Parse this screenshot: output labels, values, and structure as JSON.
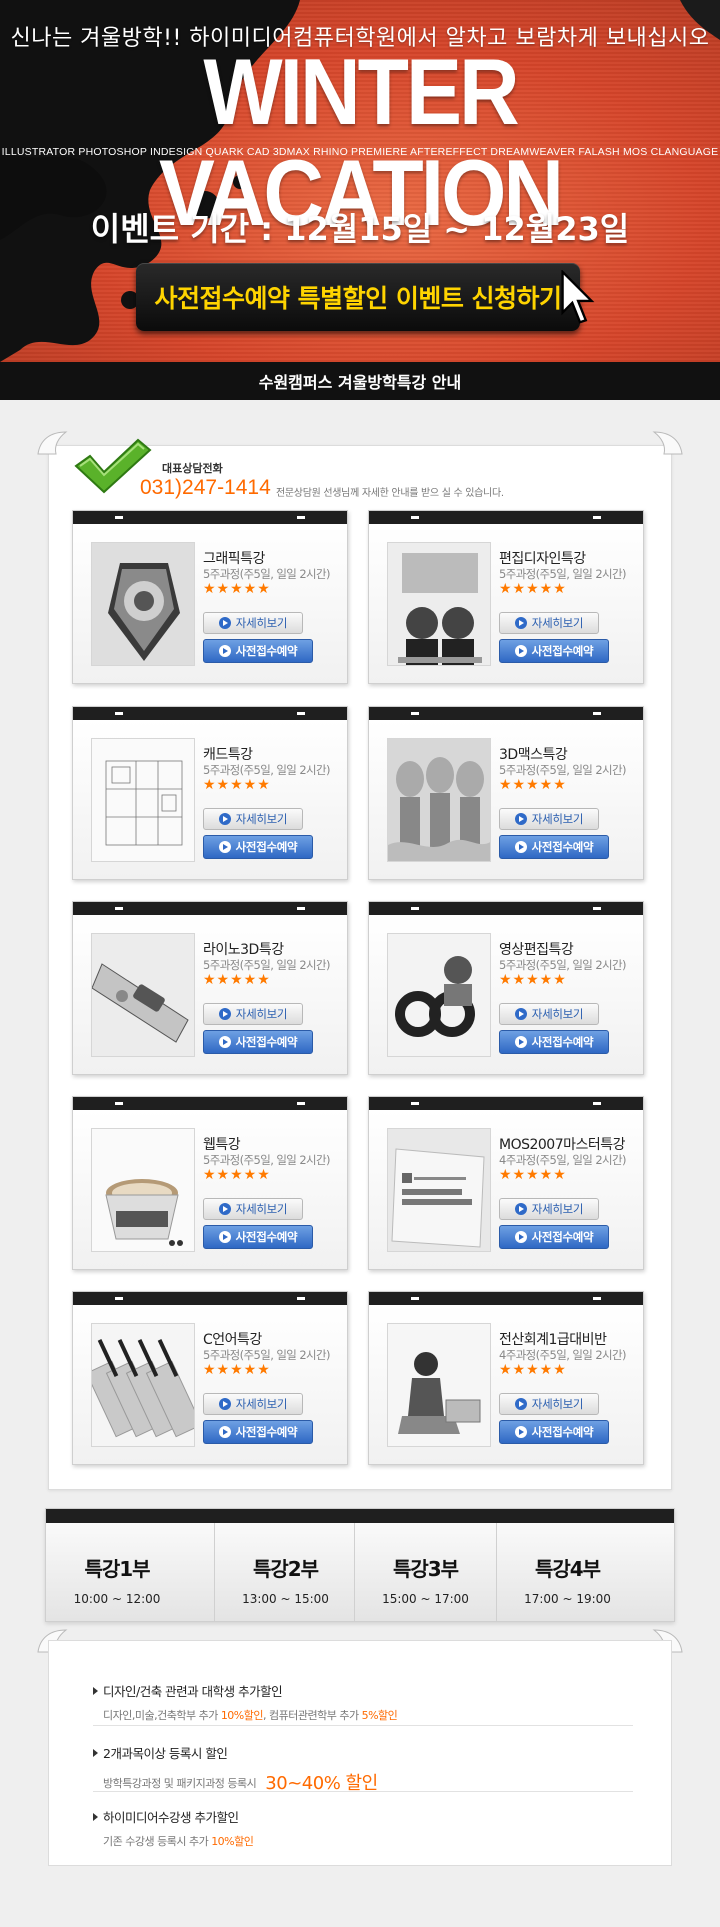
{
  "hero": {
    "tagline": "신나는 겨울방학!! 하이미디어컴퓨터학원에서 알차고 보람차게 보내십시오",
    "title": "WINTER VACATION",
    "programs": "ILLUSTRATOR  PHOTOSHOP  INDESIGN  QUARK  CAD  3DMAX  RHINO  PREMIERE  AFTEREFFECT  DREAMWEAVER  FALASH  MOS  CLANGUAGE",
    "period": "이벤트 기간 : 12월15일 ~ 12월23일",
    "cta": "사전접수예약 특별할인 이벤트 신청하기"
  },
  "subbar": {
    "title": "수원캠퍼스 겨울방학특강 안내"
  },
  "contact": {
    "label": "대표상담전화",
    "phone": "031)247-1414",
    "note": "전문상담원 선생님께 자세한 안내를 받으 실 수 있습니다."
  },
  "buttons": {
    "detail": "자세히보기",
    "reserve": "사전접수예약"
  },
  "courses": [
    {
      "title": "그래픽특강",
      "subtitle": "5주과정(주5일, 일일 2시간)",
      "stars": "★★★★★",
      "thumb": "graphic"
    },
    {
      "title": "편집디자인특강",
      "subtitle": "5주과정(주5일, 일일 2시간)",
      "stars": "★★★★★",
      "thumb": "edit"
    },
    {
      "title": "캐드특강",
      "subtitle": "5주과정(주5일, 일일 2시간)",
      "stars": "★★★★★",
      "thumb": "cad"
    },
    {
      "title": "3D맥스특강",
      "subtitle": "5주과정(주5일, 일일 2시간)",
      "stars": "★★★★★",
      "thumb": "3dmax"
    },
    {
      "title": "라이노3D특강",
      "subtitle": "5주과정(주5일, 일일 2시간)",
      "stars": "★★★★★",
      "thumb": "rhino"
    },
    {
      "title": "영상편집특강",
      "subtitle": "5주과정(주5일, 일일 2시간)",
      "stars": "★★★★★",
      "thumb": "video"
    },
    {
      "title": "웹특강",
      "subtitle": "5주과정(주5일, 일일 2시간)",
      "stars": "★★★★★",
      "thumb": "web"
    },
    {
      "title": "MOS2007마스터특강",
      "subtitle": "4주과정(주5일, 일일 2시간)",
      "stars": "★★★★★",
      "thumb": "mos"
    },
    {
      "title": "C언어특강",
      "subtitle": "5주과정(주5일, 일일 2시간)",
      "stars": "★★★★★",
      "thumb": "clang"
    },
    {
      "title": "전산회계1급대비반",
      "subtitle": "4주과정(주5일, 일일 2시간)",
      "stars": "★★★★★",
      "thumb": "account"
    }
  ],
  "schedule": [
    {
      "name": "특강1부",
      "time": "10:00 ~ 12:00"
    },
    {
      "name": "특강2부",
      "time": "13:00 ~ 15:00"
    },
    {
      "name": "특강3부",
      "time": "15:00 ~ 17:00"
    },
    {
      "name": "특강4부",
      "time": "17:00 ~ 19:00"
    }
  ],
  "discounts": [
    {
      "title": "디자인/건축 관련과 대학생 추가할인",
      "desc_a": "디자인,미술,건축학부 추가 ",
      "hl_a": "10%할인",
      "desc_b": ", 컴퓨터관련학부 추가 ",
      "hl_b": "5%할인"
    },
    {
      "title": "2개과목이상 등록시 할인",
      "desc_a": "방학특강과정 및 패키지과정 등록시 ",
      "hl_a": "30~40% 할인"
    },
    {
      "title": "하이미디어수강생 추가할인",
      "desc_a": "기존 수강생 등록시 추가 ",
      "hl_a": "10%할인"
    }
  ],
  "colors": {
    "hero_bg": "#d94d2b",
    "cta_text": "#ffd400",
    "accent_orange": "#ff6a00",
    "button_blue": "#2f68c4"
  }
}
